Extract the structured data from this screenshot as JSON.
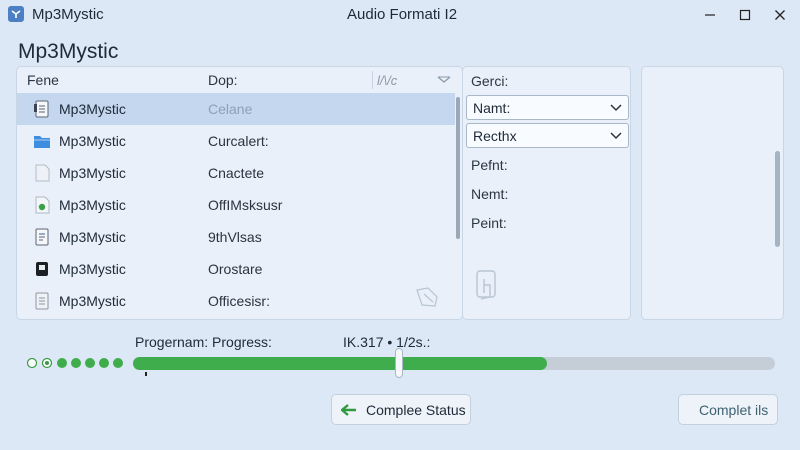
{
  "window": {
    "app_name": "Mp3Mystic",
    "title": "Audio Formati I2"
  },
  "heading": "Mp3Mystic",
  "list": {
    "columns": [
      "Fene",
      "Dop:",
      "l/\\/c"
    ],
    "rows": [
      {
        "name": "Mp3Mystic",
        "desc": "Celane",
        "icon": "document-list-icon",
        "selected": true
      },
      {
        "name": "Mp3Mystic",
        "desc": "Curcalert:",
        "icon": "folder-blue-icon",
        "selected": false
      },
      {
        "name": "Mp3Mystic",
        "desc": "Cnactete",
        "icon": "blank-page-icon",
        "selected": false
      },
      {
        "name": "Mp3Mystic",
        "desc": "OffIMsksusr",
        "icon": "green-dot-document-icon",
        "selected": false
      },
      {
        "name": "Mp3Mystic",
        "desc": "9thVlsas",
        "icon": "document-lines-icon",
        "selected": false
      },
      {
        "name": "Mp3Mystic",
        "desc": "Orostare",
        "icon": "device-icon",
        "selected": false
      },
      {
        "name": "Mp3Mystic",
        "desc": "Officesisr:",
        "icon": "document-text-icon",
        "selected": false
      }
    ]
  },
  "properties": {
    "label_top": "Gerci:",
    "combo1": "Namt:",
    "combo2": "Recthx",
    "fields": [
      "Pefnt:",
      "Nemt:",
      "Peint:"
    ]
  },
  "progress": {
    "label": "Progernam: Progress:",
    "value_text": "IK.317  •  1/2s.:",
    "fraction": 0.645
  },
  "buttons": {
    "status": "Complee Status",
    "complete": "Complet ils"
  },
  "colors": {
    "accent": "#3fad4b",
    "selection": "#c4d7ef",
    "background": "#dce8f5"
  }
}
